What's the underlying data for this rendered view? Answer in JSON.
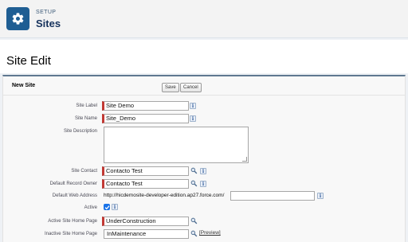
{
  "setup": {
    "kicker": "SETUP",
    "title": "Sites"
  },
  "page": {
    "title": "Site Edit"
  },
  "panel": {
    "title": "New Site",
    "save_label": "Save",
    "cancel_label": "Cancel"
  },
  "form": {
    "site_label": {
      "label": "Site Label",
      "value": "Site Demo"
    },
    "site_name": {
      "label": "Site Name",
      "value": "Site_Demo"
    },
    "site_description": {
      "label": "Site Description",
      "value": ""
    },
    "site_contact": {
      "label": "Site Contact",
      "value": "Contacto Test"
    },
    "default_record_owner": {
      "label": "Default Record Owner",
      "value": "Contacto Test"
    },
    "default_web_address": {
      "label": "Default Web Address",
      "prefix": "http://hicdemosite-developer-edition.ap27.force.com/",
      "value": ""
    },
    "active": {
      "label": "Active",
      "checked": true
    },
    "active_home_page": {
      "label": "Active Site Home Page",
      "value": "UnderConstruction"
    },
    "inactive_home_page": {
      "label": "Inactive Site Home Page",
      "value": "InMaintenance",
      "preview_label": "[Preview]"
    }
  },
  "icons": {
    "setup": "gear-icon",
    "info": "info-icon",
    "lookup": "lookup-icon",
    "check": "check-icon"
  },
  "colors": {
    "brand": "#1f5e93",
    "required": "#c23934",
    "checkbox": "#1a73e8"
  }
}
